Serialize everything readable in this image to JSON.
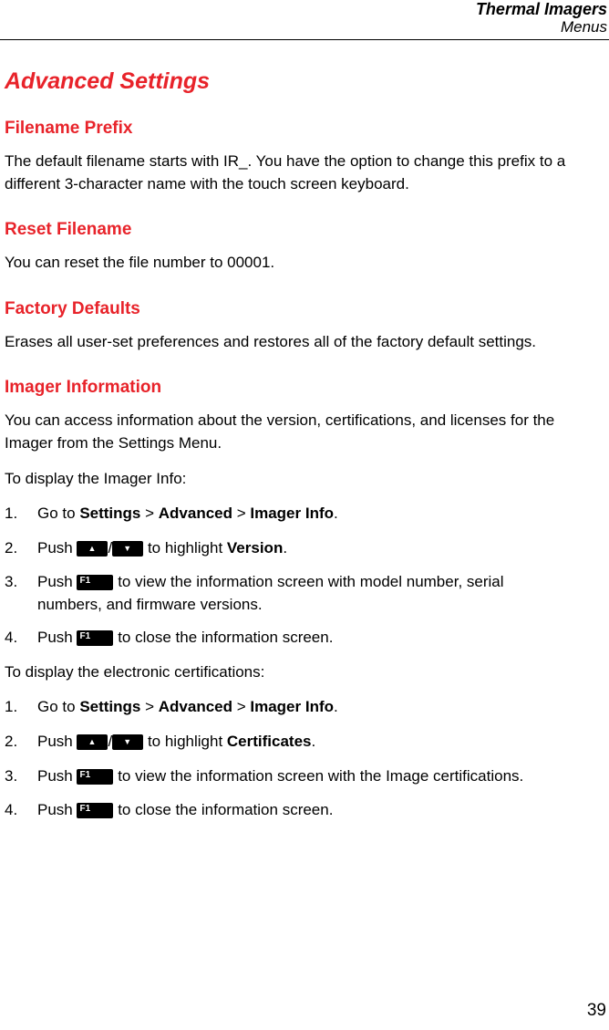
{
  "header": {
    "title": "Thermal Imagers",
    "subtitle": "Menus"
  },
  "page_title": "Advanced Settings",
  "sections": [
    {
      "heading": "Filename Prefix",
      "text": "The default filename starts with IR_. You have the option to change this prefix to a different 3-character name with the touch screen keyboard."
    },
    {
      "heading": "Reset Filename",
      "text": "You can reset the file number to 00001."
    },
    {
      "heading": "Factory Defaults",
      "text": "Erases all user-set preferences and restores all of the factory default settings."
    },
    {
      "heading": "Imager Information",
      "text": "You can access information about the version, certifications, and licenses for the Imager from the Settings Menu."
    }
  ],
  "procedure1": {
    "intro": "To display the Imager Info:",
    "steps": [
      {
        "num": "1.",
        "pre": "Go to ",
        "b1": "Settings",
        "sep1": " > ",
        "b2": "Advanced",
        "sep2": " > ",
        "b3": "Imager Info",
        "post": "."
      },
      {
        "num": "2.",
        "pre": "Push ",
        "slash": "/",
        "mid": " to highlight ",
        "bold": "Version",
        "post": "."
      },
      {
        "num": "3.",
        "pre": "Push ",
        "post": " to view the information screen with model number, serial",
        "cont": "numbers, and firmware versions."
      },
      {
        "num": "4.",
        "pre": "Push ",
        "post": " to close the information screen."
      }
    ]
  },
  "procedure2": {
    "intro": "To display the electronic certifications:",
    "steps": [
      {
        "num": "1.",
        "pre": "Go to ",
        "b1": "Settings",
        "sep1": " > ",
        "b2": "Advanced",
        "sep2": " > ",
        "b3": "Imager Info",
        "post": "."
      },
      {
        "num": "2.",
        "pre": "Push ",
        "slash": "/",
        "mid": " to highlight ",
        "bold": "Certificates",
        "post": "."
      },
      {
        "num": "3.",
        "pre": "Push ",
        "post": " to view the information screen with the Image certifications."
      },
      {
        "num": "4.",
        "pre": "Push ",
        "post": " to close the information screen."
      }
    ]
  },
  "keys": {
    "up": "▲",
    "down": "▼",
    "f1": "F1"
  },
  "page_number": "39",
  "colors": {
    "heading": "#e8232a"
  }
}
